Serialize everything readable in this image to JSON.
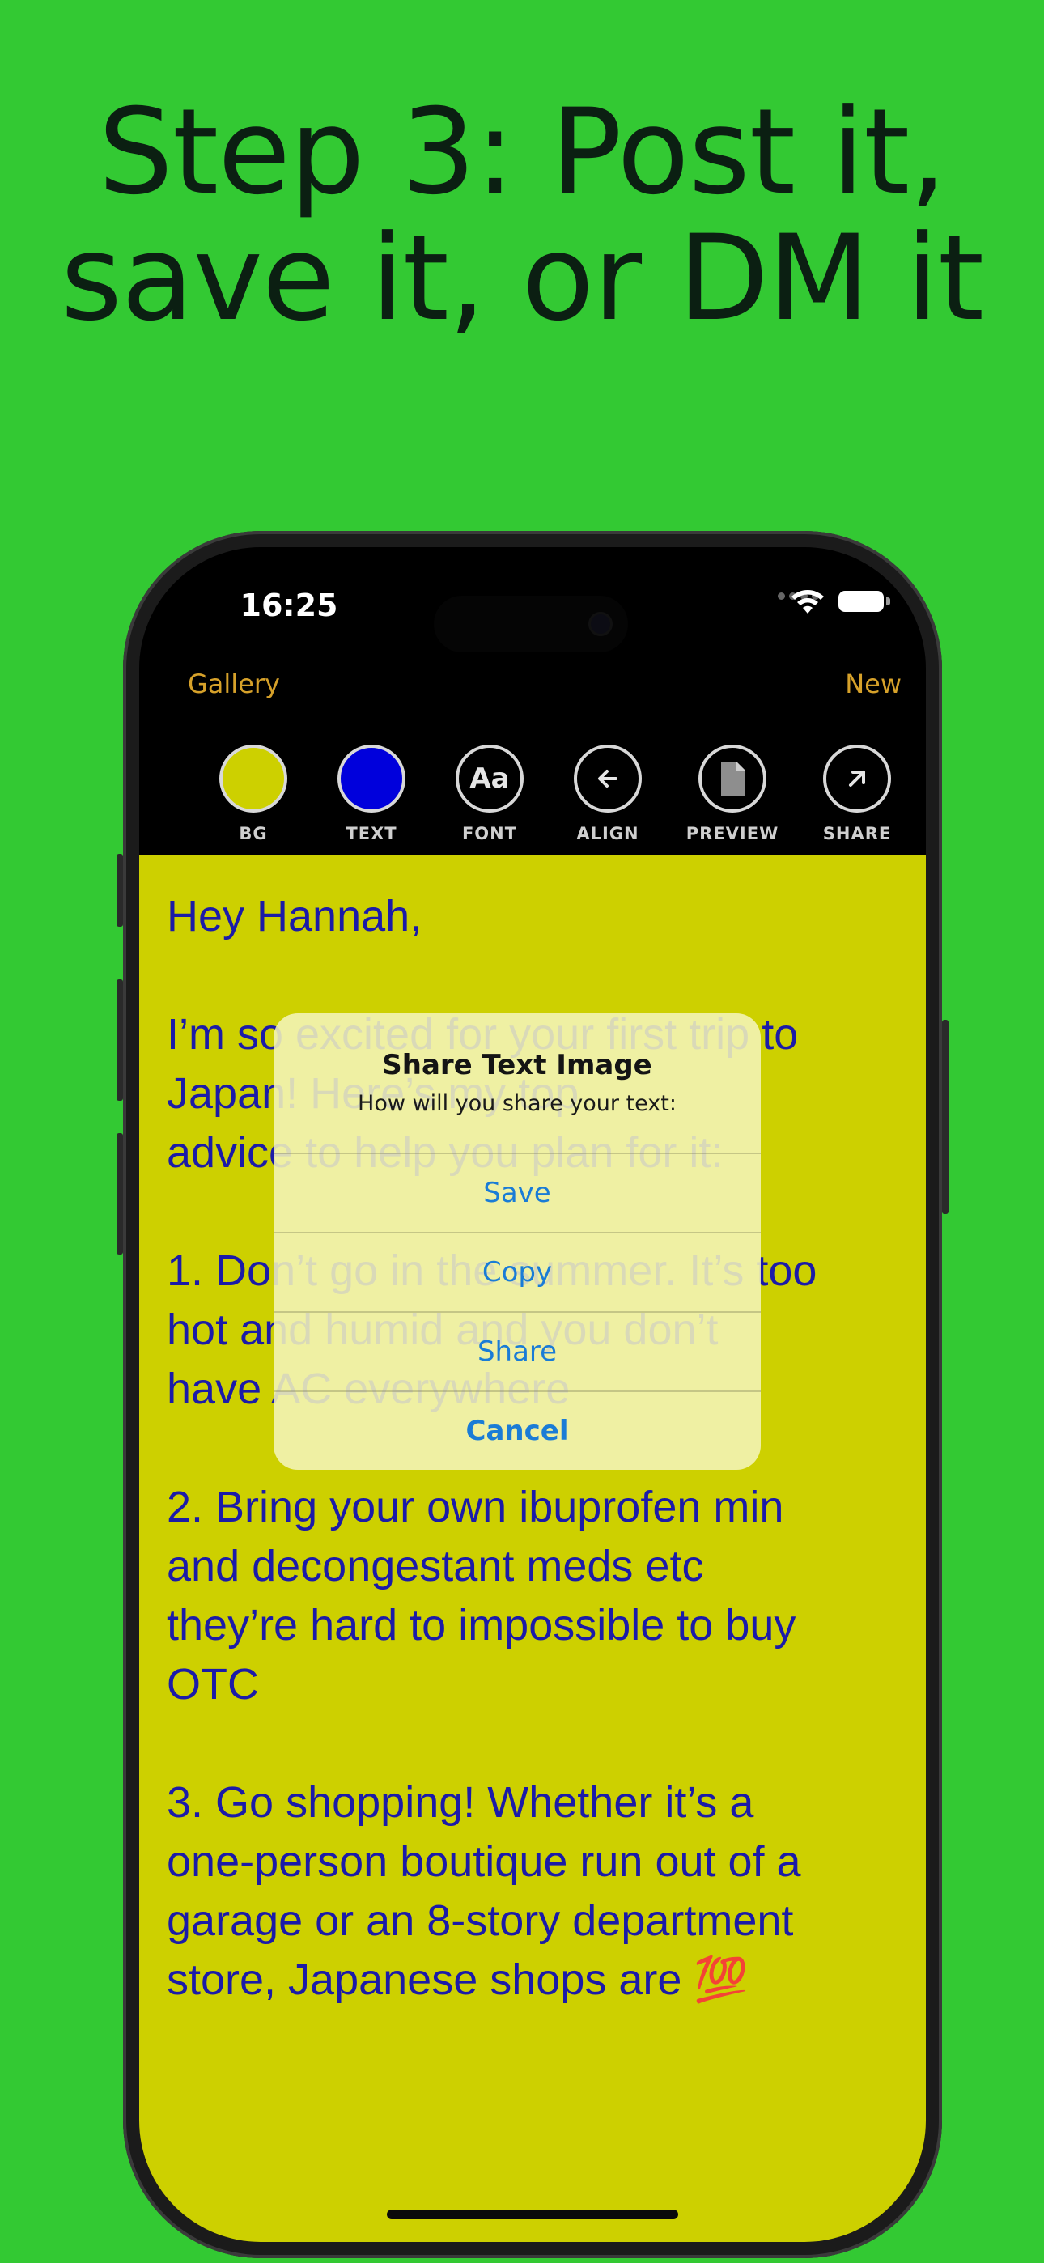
{
  "headline": {
    "line1": "Step 3: Post it,",
    "line2": "save it, or DM it"
  },
  "status_bar": {
    "time": "16:25"
  },
  "nav": {
    "left": "Gallery",
    "right": "New"
  },
  "toolbar": {
    "items": [
      {
        "label": "BG",
        "icon": "bg-color-swatch",
        "color": "#cdd000"
      },
      {
        "label": "TEXT",
        "icon": "text-color-swatch",
        "color": "#0000dc"
      },
      {
        "label": "FONT",
        "icon": "font-icon",
        "glyph": "Aa"
      },
      {
        "label": "ALIGN",
        "icon": "arrow-left-icon"
      },
      {
        "label": "PREVIEW",
        "icon": "document-icon"
      },
      {
        "label": "SHARE",
        "icon": "arrow-up-right-icon"
      }
    ]
  },
  "canvas": {
    "background": "#cdd000",
    "text_color": "#1b1ba8",
    "text": "Hey Hannah,\n\nI’m so excited for your first trip to\nJapan! Here’s my top\nadvice to help you plan for it:\n\n1. Don’t go in the summer. It’s too\nhot and humid and you don’t\nhave AC everywhere\n\n2. Bring your own ibuprofen min\nand decongestant meds etc\nthey’re hard to impossible to buy\nOTC\n\n3. Go shopping! Whether it’s a\none-person boutique run out of a\ngarage or an 8-story department\nstore, Japanese shops are 💯"
  },
  "alert": {
    "title": "Share Text Image",
    "message": "How will you share your text:",
    "actions": {
      "save": "Save",
      "copy": "Copy",
      "share": "Share",
      "cancel": "Cancel"
    }
  },
  "colors": {
    "page_bg": "#33c933",
    "accent_nav": "#d6a12a",
    "alert_action": "#1a7cd6"
  }
}
